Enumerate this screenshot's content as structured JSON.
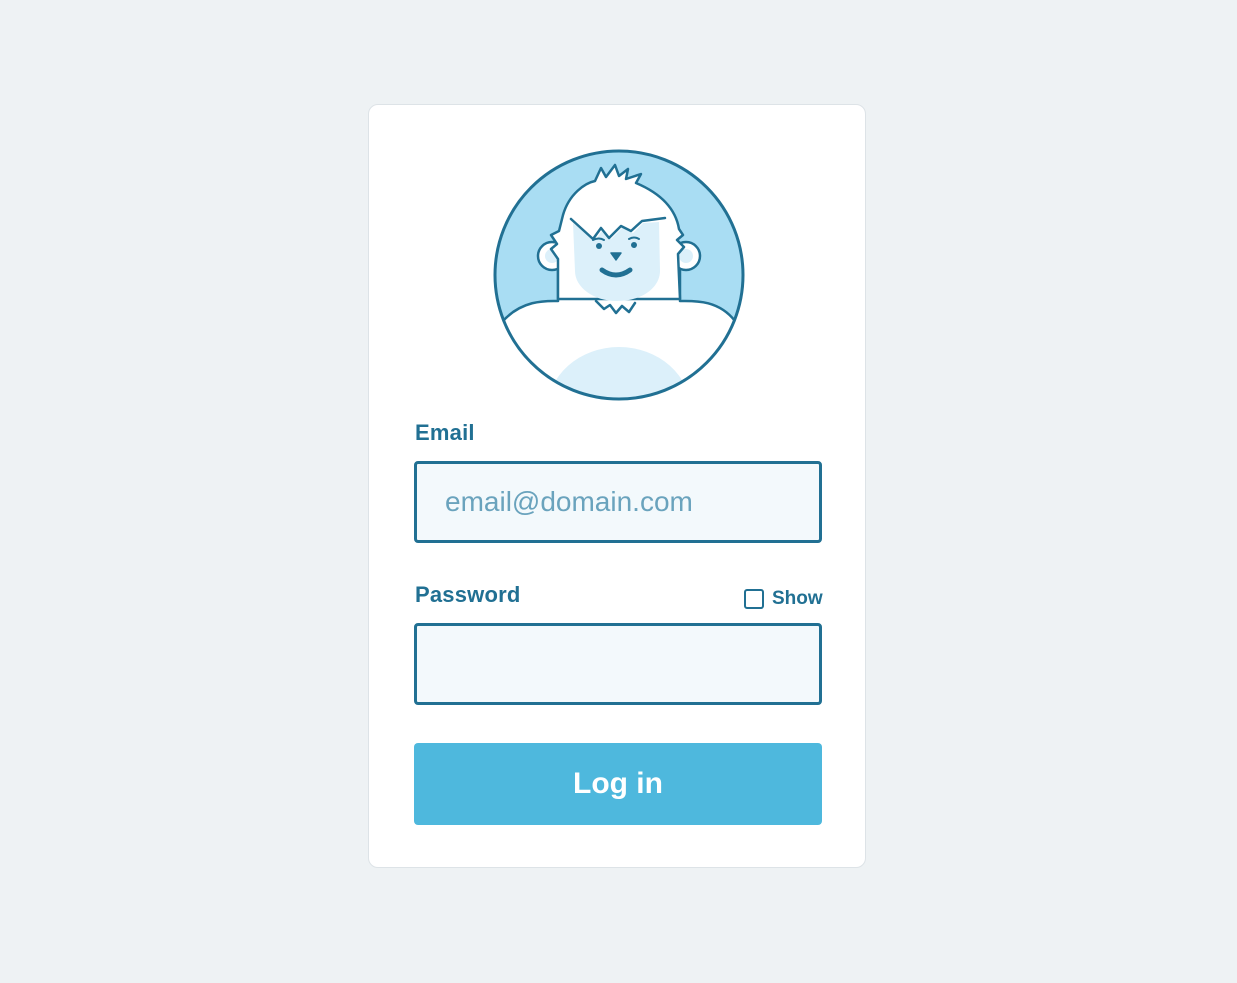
{
  "form": {
    "avatar_icon": "yeti-avatar-icon",
    "email": {
      "label": "Email",
      "placeholder": "email@domain.com",
      "value": ""
    },
    "password": {
      "label": "Password",
      "value": "",
      "show_label": "Show",
      "show_checked": false
    },
    "login_button_label": "Log in"
  },
  "colors": {
    "background": "#eef2f4",
    "card": "#ffffff",
    "accent": "#217093",
    "button": "#4eb8dd",
    "avatar_sky": "#a9ddf3",
    "field_bg": "#f3f9fc"
  }
}
